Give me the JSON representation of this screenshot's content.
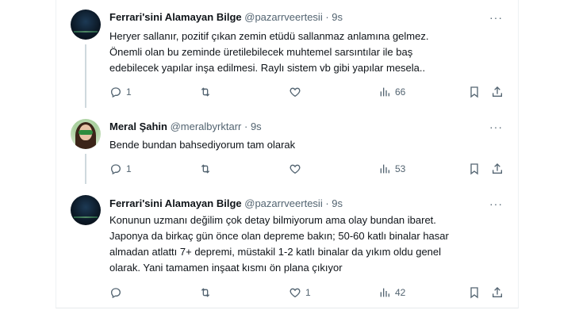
{
  "tweets": [
    {
      "name": "Ferrari'sini Alamayan Bilge",
      "handle": "@pazarrveertesii",
      "sep": "·",
      "time": "9s",
      "lines": [
        "Heryer sallanır, pozitif çıkan zemin etüdü sallanmaz anlamına gelmez.",
        "Önemli olan bu zeminde üretilebilecek muhtemel sarsıntılar ile baş",
        "edebilecek yapılar inşa edilmesi. Raylı sistem vb gibi yapılar mesela.."
      ],
      "replies": "1",
      "retweets": "",
      "likes": "",
      "views": "66"
    },
    {
      "name": "Meral Şahin",
      "handle": "@meralbyrktarr",
      "sep": "·",
      "time": "9s",
      "lines": [
        "Bende bundan bahsediyorum tam olarak"
      ],
      "replies": "1",
      "retweets": "",
      "likes": "",
      "views": "53"
    },
    {
      "name": "Ferrari'sini Alamayan Bilge",
      "handle": "@pazarrveertesii",
      "sep": "·",
      "time": "9s",
      "lines": [
        "Konunun uzmanı değilim çok detay bilmiyorum ama olay bundan ibaret.",
        "Japonya da birkaç gün önce olan depreme bakın; 50-60 katlı binalar hasar",
        "almadan atlattı 7+ depremi, müstakil 1-2 katlı binalar da yıkım oldu genel",
        "olarak. Yani tamamen inşaat kısmı ön plana çıkıyor"
      ],
      "replies": "",
      "retweets": "",
      "likes": "1",
      "views": "42"
    }
  ],
  "more_label": "···",
  "icons": {
    "reply": "reply-icon",
    "retweet": "retweet-icon",
    "like": "heart-icon",
    "views": "analytics-icon",
    "bookmark": "bookmark-icon",
    "share": "share-icon"
  },
  "colors": {
    "text": "#0f1419",
    "secondary": "#536471",
    "thread": "#cfd9de"
  }
}
